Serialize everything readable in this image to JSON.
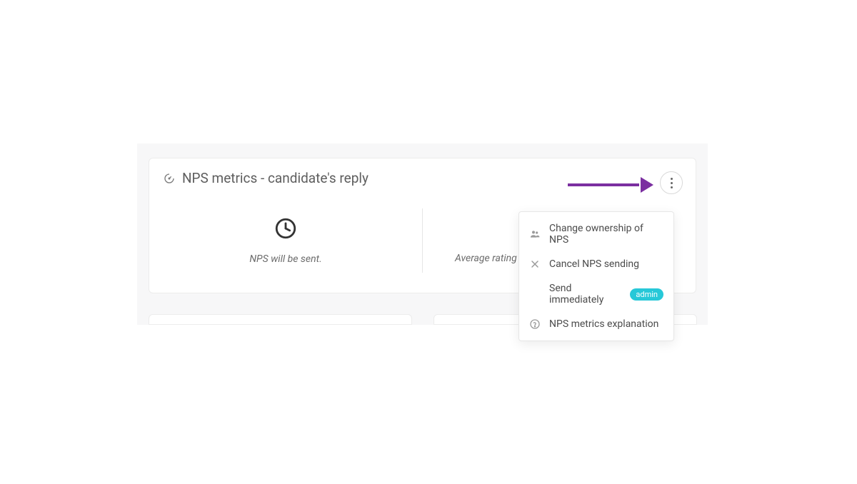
{
  "card": {
    "title": "NPS metrics - candidate's reply",
    "status_text": "NPS will be sent.",
    "average_text": "Average rating of th"
  },
  "menu": {
    "change_ownership": "Change ownership of NPS",
    "cancel_sending": "Cancel NPS sending",
    "send_immediately": "Send immediately",
    "admin_badge": "admin",
    "explanation": "NPS metrics explanation"
  }
}
